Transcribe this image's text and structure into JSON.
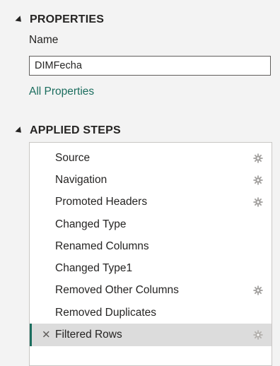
{
  "properties": {
    "header": "PROPERTIES",
    "name_label": "Name",
    "name_value": "DIMFecha",
    "all_properties_link": "All Properties"
  },
  "applied_steps": {
    "header": "APPLIED STEPS",
    "steps": [
      {
        "label": "Source",
        "has_settings": true,
        "selected": false
      },
      {
        "label": "Navigation",
        "has_settings": true,
        "selected": false
      },
      {
        "label": "Promoted Headers",
        "has_settings": true,
        "selected": false
      },
      {
        "label": "Changed Type",
        "has_settings": false,
        "selected": false
      },
      {
        "label": "Renamed Columns",
        "has_settings": false,
        "selected": false
      },
      {
        "label": "Changed Type1",
        "has_settings": false,
        "selected": false
      },
      {
        "label": "Removed Other Columns",
        "has_settings": true,
        "selected": false
      },
      {
        "label": "Removed Duplicates",
        "has_settings": false,
        "selected": false
      },
      {
        "label": "Filtered Rows",
        "has_settings": true,
        "selected": true
      }
    ]
  },
  "icons": {
    "collapse": "collapse-triangle-icon",
    "settings": "gear-icon",
    "delete": "close-icon"
  },
  "colors": {
    "accent": "#1b6d5e",
    "pane_background": "#f3f3f3",
    "selected_row": "#dcdcdc",
    "gear": "#a19f9d"
  }
}
